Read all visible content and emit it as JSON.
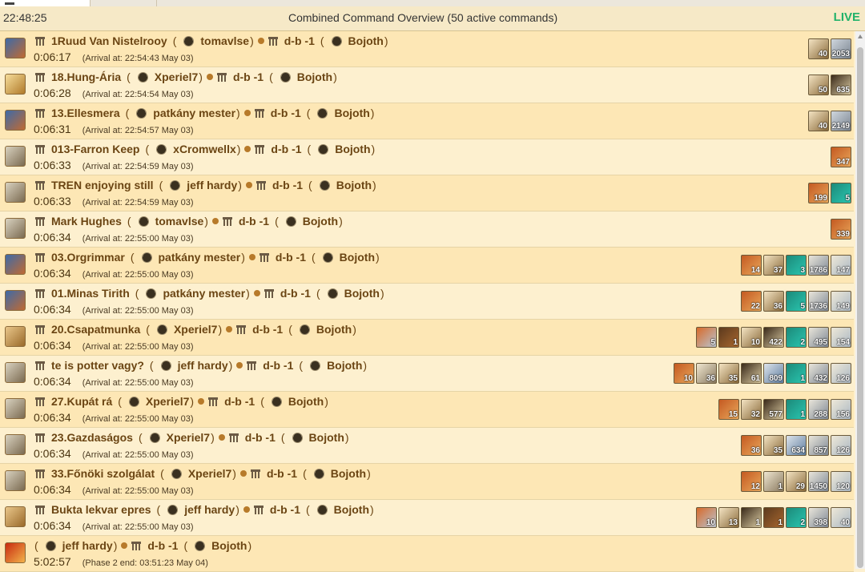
{
  "header": {
    "time": "22:48:25",
    "title": "Combined Command Overview  (50 active commands)",
    "live": "LIVE"
  },
  "commands": [
    {
      "icon": "ram-icon",
      "origin": "1Ruud Van Nistelrooy",
      "player": "tomavlse",
      "target": "d-b -1",
      "target_player": "Bojoth",
      "timer": "0:06:17",
      "arrival": "(Arrival at: 22:54:43 May 03)",
      "units": [
        {
          "icon": "ram-unit-icon",
          "count": "40"
        },
        {
          "icon": "spear-unit-icon",
          "count": "2053"
        }
      ]
    },
    {
      "icon": "sword-icon",
      "origin": "18.Hung-Ária",
      "player": "Xperiel7",
      "target": "d-b -1",
      "target_player": "Bojoth",
      "timer": "0:06:28",
      "arrival": "(Arrival at: 22:54:54 May 03)",
      "units": [
        {
          "icon": "ram-unit-icon",
          "count": "50"
        },
        {
          "icon": "catapult-unit-icon",
          "count": "635"
        }
      ]
    },
    {
      "icon": "ram-icon",
      "origin": "13.Ellesmera",
      "player": "patkány mester",
      "target": "d-b -1",
      "target_player": "Bojoth",
      "timer": "0:06:31",
      "arrival": "(Arrival at: 22:54:57 May 03)",
      "units": [
        {
          "icon": "ram-unit-icon",
          "count": "40"
        },
        {
          "icon": "spear-unit-icon",
          "count": "2149"
        }
      ]
    },
    {
      "icon": "scout-icon",
      "origin": "013-Farron Keep",
      "player": "xCromwellx",
      "target": "d-b -1",
      "target_player": "Bojoth",
      "timer": "0:06:33",
      "arrival": "(Arrival at: 22:54:59 May 03)",
      "units": [
        {
          "icon": "flame-unit-icon",
          "count": "347"
        }
      ]
    },
    {
      "icon": "scout-icon",
      "origin": "TREN enjoying still",
      "player": "jeff hardy",
      "target": "d-b -1",
      "target_player": "Bojoth",
      "timer": "0:06:33",
      "arrival": "(Arrival at: 22:54:59 May 03)",
      "units": [
        {
          "icon": "flame-unit-icon",
          "count": "199"
        },
        {
          "icon": "sea-monster-unit-icon",
          "count": "5"
        }
      ]
    },
    {
      "icon": "scout-icon",
      "origin": "Mark Hughes",
      "player": "tomavlse",
      "target": "d-b -1",
      "target_player": "Bojoth",
      "timer": "0:06:34",
      "arrival": "(Arrival at: 22:55:00 May 03)",
      "units": [
        {
          "icon": "flame-unit-icon",
          "count": "339"
        }
      ]
    },
    {
      "icon": "ram-icon",
      "origin": "03.Orgrimmar",
      "player": "patkány mester",
      "target": "d-b -1",
      "target_player": "Bojoth",
      "timer": "0:06:34",
      "arrival": "(Arrival at: 22:55:00 May 03)",
      "units": [
        {
          "icon": "flame-unit-icon",
          "count": "14"
        },
        {
          "icon": "ram-unit-icon",
          "count": "37"
        },
        {
          "icon": "sea-monster-unit-icon",
          "count": "3"
        },
        {
          "icon": "hoplite-unit-icon",
          "count": "1786"
        },
        {
          "icon": "ship-unit-icon",
          "count": "147"
        }
      ]
    },
    {
      "icon": "ram-icon",
      "origin": "01.Minas Tirith",
      "player": "patkány mester",
      "target": "d-b -1",
      "target_player": "Bojoth",
      "timer": "0:06:34",
      "arrival": "(Arrival at: 22:55:00 May 03)",
      "units": [
        {
          "icon": "flame-unit-icon",
          "count": "22"
        },
        {
          "icon": "ram-unit-icon",
          "count": "36"
        },
        {
          "icon": "sea-monster-unit-icon",
          "count": "5"
        },
        {
          "icon": "hoplite-unit-icon",
          "count": "1736"
        },
        {
          "icon": "ship-unit-icon",
          "count": "149"
        }
      ]
    },
    {
      "icon": "spear-icon",
      "origin": "20.Csapatmunka",
      "player": "Xperiel7",
      "target": "d-b -1",
      "target_player": "Bojoth",
      "timer": "0:06:34",
      "arrival": "(Arrival at: 22:55:00 May 03)",
      "units": [
        {
          "icon": "fireship-unit-icon",
          "count": "5"
        },
        {
          "icon": "boat-unit-icon",
          "count": "1"
        },
        {
          "icon": "ram-unit-icon",
          "count": "10"
        },
        {
          "icon": "catapult-unit-icon",
          "count": "422"
        },
        {
          "icon": "sea-monster-unit-icon",
          "count": "2"
        },
        {
          "icon": "hoplite-unit-icon",
          "count": "495"
        },
        {
          "icon": "ship-unit-icon",
          "count": "154"
        }
      ]
    },
    {
      "icon": "scout-icon",
      "origin": "te is potter vagy?",
      "player": "jeff hardy",
      "target": "d-b -1",
      "target_player": "Bojoth",
      "timer": "0:06:34",
      "arrival": "(Arrival at: 22:55:00 May 03)",
      "units": [
        {
          "icon": "flame-unit-icon",
          "count": "10"
        },
        {
          "icon": "sail-unit-icon",
          "count": "36"
        },
        {
          "icon": "ram-unit-icon",
          "count": "35"
        },
        {
          "icon": "catapult-unit-icon",
          "count": "61"
        },
        {
          "icon": "myth-unit-icon",
          "count": "809"
        },
        {
          "icon": "sea-monster-unit-icon",
          "count": "1"
        },
        {
          "icon": "hoplite-unit-icon",
          "count": "432"
        },
        {
          "icon": "ship-unit-icon",
          "count": "126"
        }
      ]
    },
    {
      "icon": "scout-icon",
      "origin": "27.Kupát rá",
      "player": "Xperiel7",
      "target": "d-b -1",
      "target_player": "Bojoth",
      "timer": "0:06:34",
      "arrival": "(Arrival at: 22:55:00 May 03)",
      "units": [
        {
          "icon": "flame-unit-icon",
          "count": "15"
        },
        {
          "icon": "ram-unit-icon",
          "count": "32"
        },
        {
          "icon": "catapult-unit-icon",
          "count": "577"
        },
        {
          "icon": "sea-monster-unit-icon",
          "count": "1"
        },
        {
          "icon": "hoplite-unit-icon",
          "count": "288"
        },
        {
          "icon": "ship-unit-icon",
          "count": "156"
        }
      ]
    },
    {
      "icon": "scout-icon",
      "origin": "23.Gazdaságos",
      "player": "Xperiel7",
      "target": "d-b -1",
      "target_player": "Bojoth",
      "timer": "0:06:34",
      "arrival": "(Arrival at: 22:55:00 May 03)",
      "units": [
        {
          "icon": "flame-unit-icon",
          "count": "36"
        },
        {
          "icon": "ram-unit-icon",
          "count": "35"
        },
        {
          "icon": "myth-unit-icon",
          "count": "634"
        },
        {
          "icon": "hoplite-unit-icon",
          "count": "857"
        },
        {
          "icon": "ship-unit-icon",
          "count": "126"
        }
      ]
    },
    {
      "icon": "scout-icon",
      "origin": "33.Főnöki szolgálat",
      "player": "Xperiel7",
      "target": "d-b -1",
      "target_player": "Bojoth",
      "timer": "0:06:34",
      "arrival": "(Arrival at: 22:55:00 May 03)",
      "units": [
        {
          "icon": "flame-unit-icon",
          "count": "12"
        },
        {
          "icon": "sail-unit-icon",
          "count": "1"
        },
        {
          "icon": "ram-unit-icon",
          "count": "29"
        },
        {
          "icon": "hoplite-unit-icon",
          "count": "1450"
        },
        {
          "icon": "ship-unit-icon",
          "count": "120"
        }
      ]
    },
    {
      "icon": "spear-icon",
      "origin": "Bukta lekvar epres",
      "player": "jeff hardy",
      "target": "d-b -1",
      "target_player": "Bojoth",
      "timer": "0:06:34",
      "arrival": "(Arrival at: 22:55:00 May 03)",
      "units": [
        {
          "icon": "fireship-unit-icon",
          "count": "10"
        },
        {
          "icon": "ram-unit-icon",
          "count": "13"
        },
        {
          "icon": "catapult-unit-icon",
          "count": "1"
        },
        {
          "icon": "boat-unit-icon",
          "count": "1"
        },
        {
          "icon": "sea-monster-unit-icon",
          "count": "2"
        },
        {
          "icon": "hoplite-unit-icon",
          "count": "398"
        },
        {
          "icon": "ship-unit-icon",
          "count": "40"
        }
      ]
    },
    {
      "icon": "fire-icon",
      "origin": "",
      "player": "jeff hardy",
      "target": "d-b -1",
      "target_player": "Bojoth",
      "timer": "5:02:57",
      "arrival": "(Phase 2 end: 03:51:23 May 04)",
      "units": []
    }
  ]
}
